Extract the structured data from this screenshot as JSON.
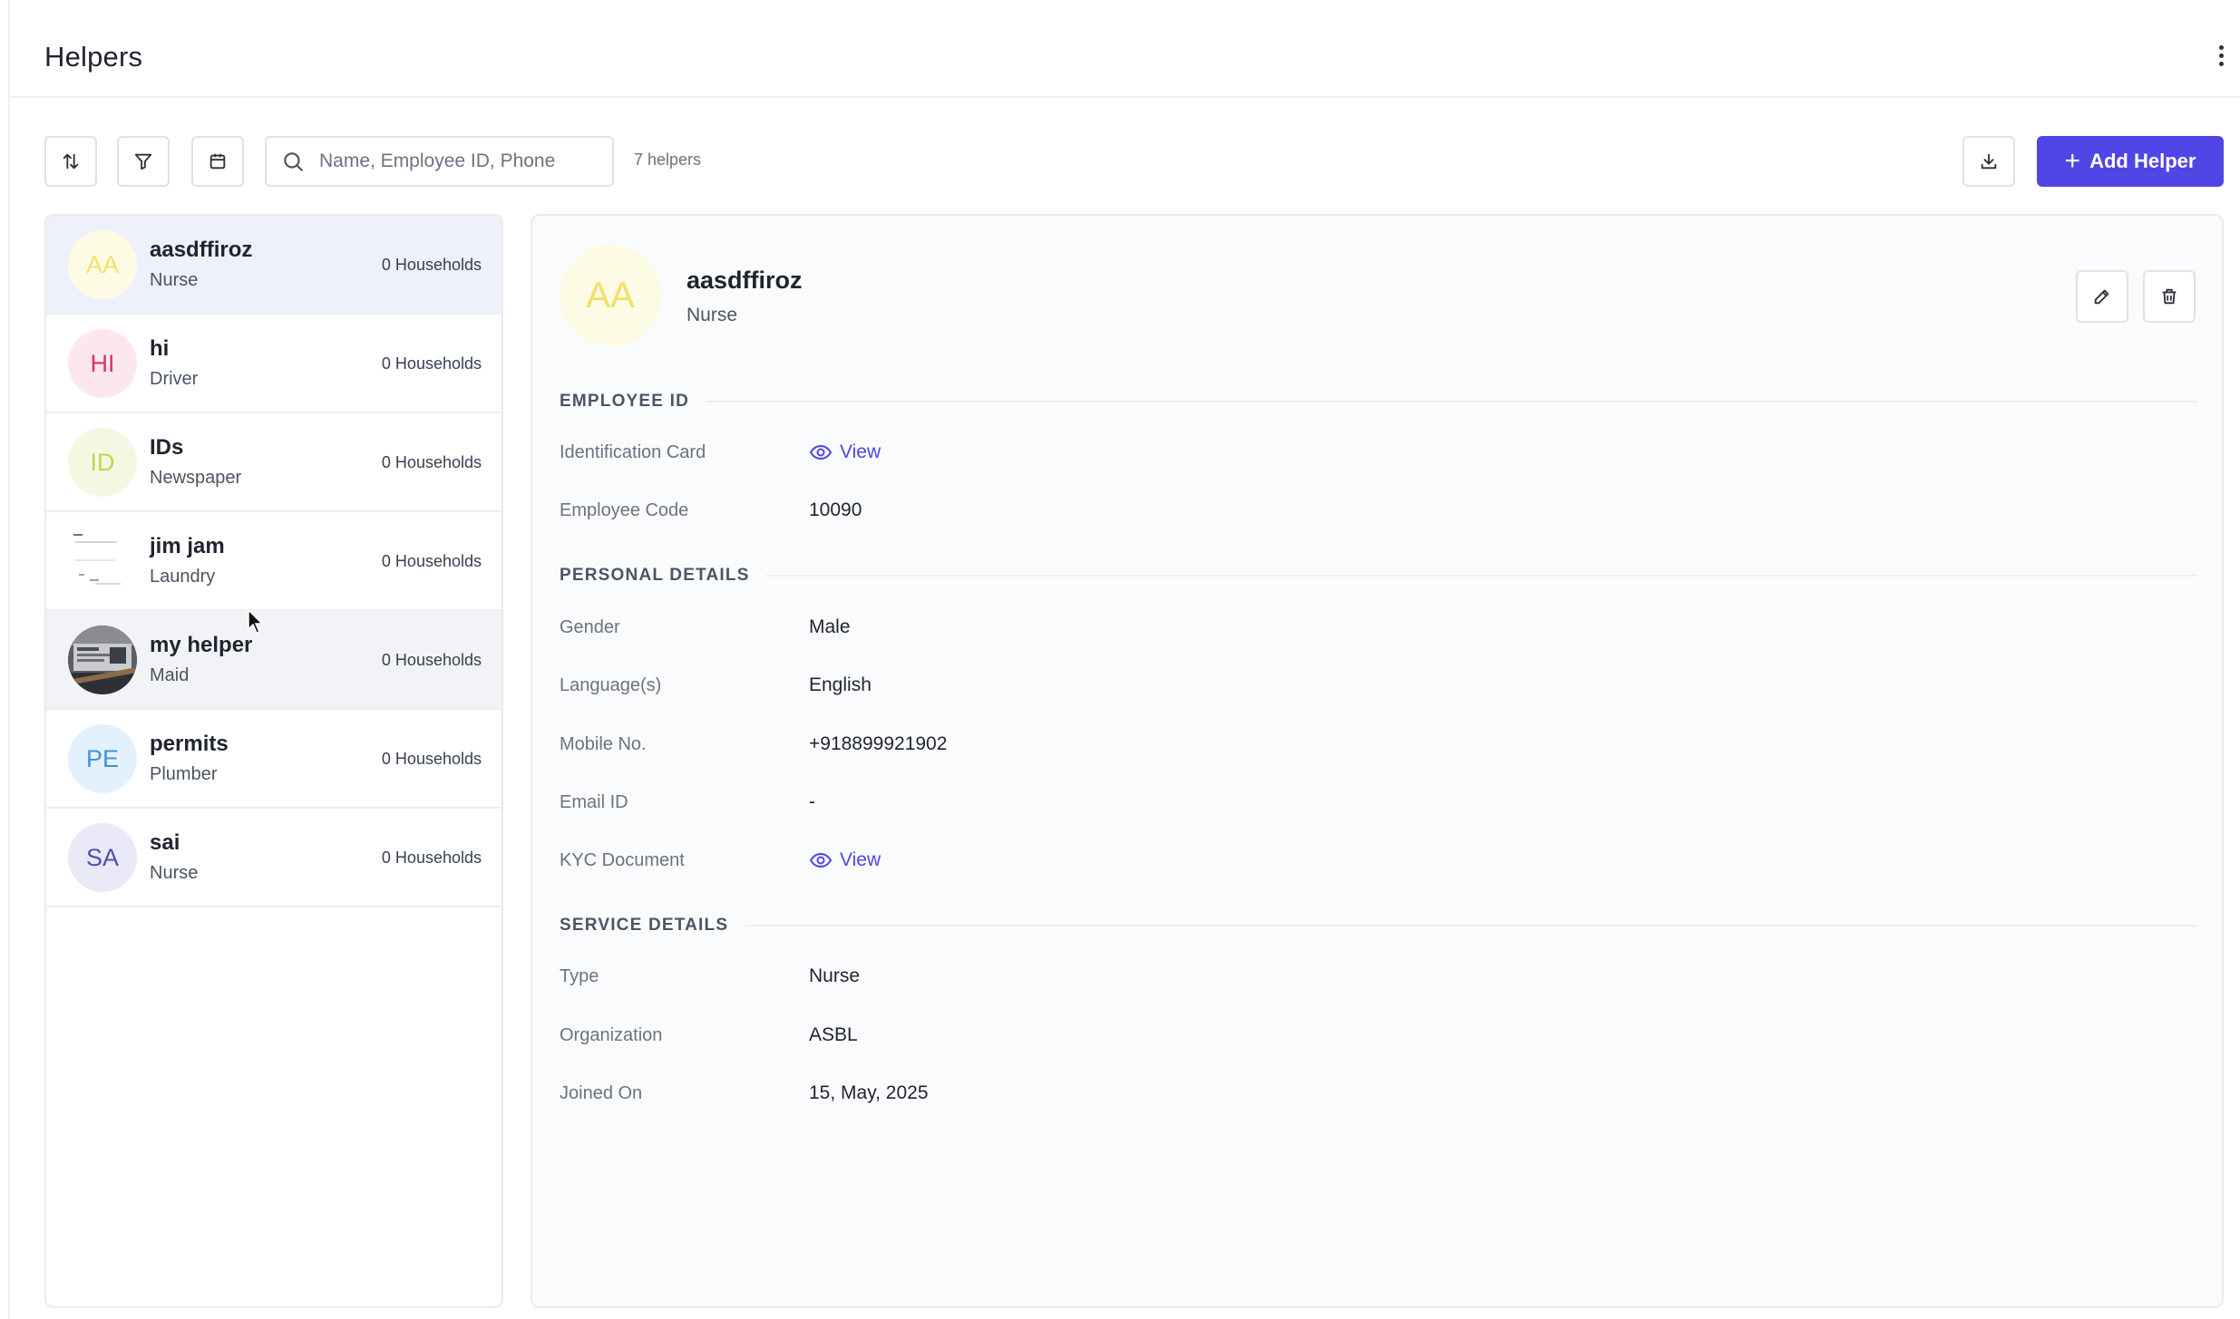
{
  "header": {
    "title": "Helpers"
  },
  "toolbar": {
    "search_placeholder": "Name, Employee ID, Phone",
    "count_label": "7 helpers",
    "add_label": "Add Helper"
  },
  "helpers": [
    {
      "initials": "AA",
      "name": "aasdffiroz",
      "role": "Nurse",
      "households": "0 Households"
    },
    {
      "initials": "HI",
      "name": "hi",
      "role": "Driver",
      "households": "0 Households"
    },
    {
      "initials": "ID",
      "name": "IDs",
      "role": "Newspaper",
      "households": "0 Households"
    },
    {
      "initials": "",
      "name": "jim jam",
      "role": "Laundry",
      "households": "0 Households"
    },
    {
      "initials": "",
      "name": "my helper",
      "role": "Maid",
      "households": "0 Households"
    },
    {
      "initials": "PE",
      "name": "permits",
      "role": "Plumber",
      "households": "0 Households"
    },
    {
      "initials": "SA",
      "name": "sai",
      "role": "Nurse",
      "households": "0 Households"
    }
  ],
  "detail": {
    "initials": "AA",
    "name": "aasdffiroz",
    "role": "Nurse",
    "sections": {
      "employee_id": "EMPLOYEE ID",
      "personal": "PERSONAL DETAILS",
      "service": "SERVICE DETAILS"
    },
    "fields": {
      "identification_card": {
        "label": "Identification Card",
        "value": "View"
      },
      "employee_code": {
        "label": "Employee Code",
        "value": "10090"
      },
      "gender": {
        "label": "Gender",
        "value": "Male"
      },
      "languages": {
        "label": "Language(s)",
        "value": "English"
      },
      "mobile": {
        "label": "Mobile No.",
        "value": "+918899921902"
      },
      "email": {
        "label": "Email ID",
        "value": "-"
      },
      "kyc": {
        "label": "KYC Document",
        "value": "View"
      },
      "type": {
        "label": "Type",
        "value": "Nurse"
      },
      "organization": {
        "label": "Organization",
        "value": "ASBL"
      },
      "joined_on": {
        "label": "Joined On",
        "value": "15, May, 2025"
      }
    }
  },
  "colors": {
    "accent": "#4f46e5",
    "selected_row": "#eef0fb",
    "avatar_aa_bg": "#fdfbe3",
    "avatar_aa_fg": "#f1e16a",
    "avatar_hi_bg": "#fde7ee",
    "avatar_hi_fg": "#d6386a",
    "avatar_id_bg": "#f4f8e3",
    "avatar_id_fg": "#c8d24a",
    "avatar_pe_bg": "#e3f1fc",
    "avatar_pe_fg": "#3f93d8",
    "avatar_sa_bg": "#e9e9f7",
    "avatar_sa_fg": "#4f4fb0"
  }
}
